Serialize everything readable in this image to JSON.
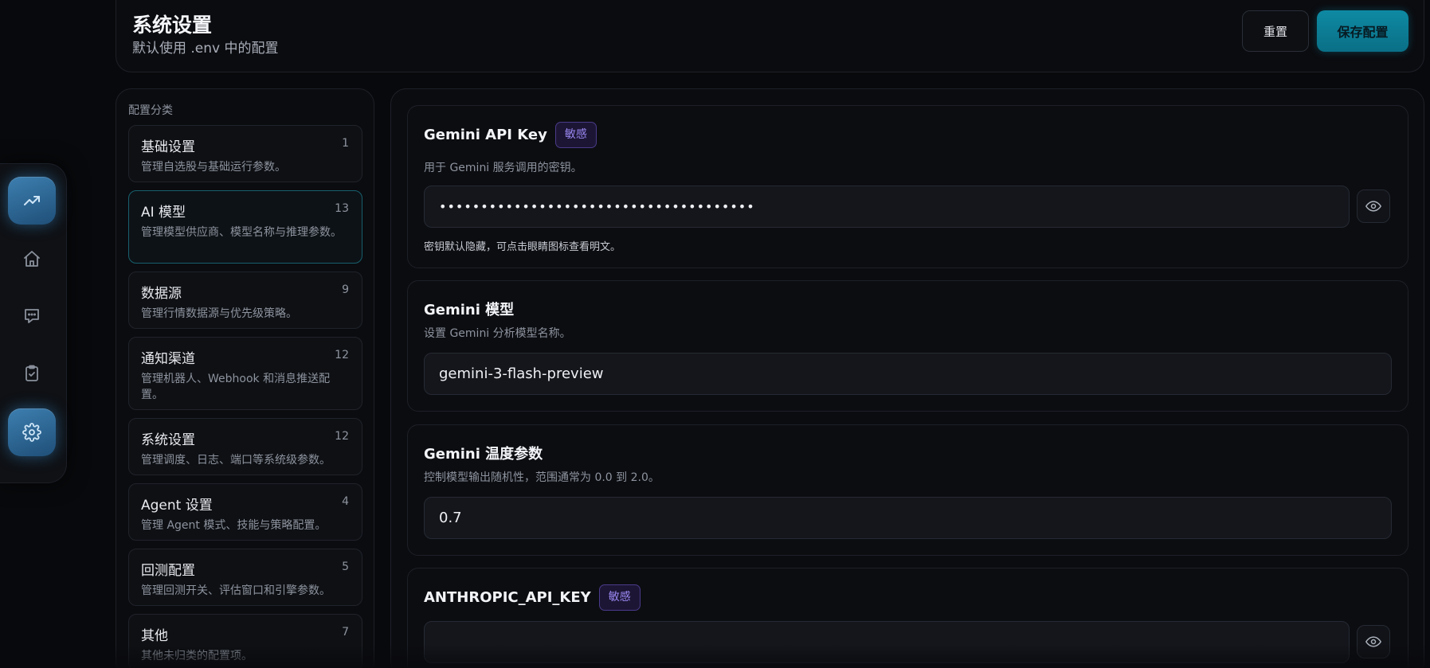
{
  "header": {
    "title": "系统设置",
    "subtitle": "默认使用 .env 中的配置",
    "reset_label": "重置",
    "save_label": "保存配置"
  },
  "nav": {
    "items": [
      {
        "icon": "trending-up-icon",
        "active": true
      },
      {
        "icon": "home-icon",
        "active": false
      },
      {
        "icon": "chat-icon",
        "active": false
      },
      {
        "icon": "clipboard-check-icon",
        "active": false
      },
      {
        "icon": "gear-icon",
        "active": true
      }
    ]
  },
  "categories": {
    "heading": "配置分类",
    "items": [
      {
        "name": "基础设置",
        "count": "1",
        "desc": "管理自选股与基础运行参数。"
      },
      {
        "name": "AI 模型",
        "count": "13",
        "desc": "管理模型供应商、模型名称与推理参数。"
      },
      {
        "name": "数据源",
        "count": "9",
        "desc": "管理行情数据源与优先级策略。"
      },
      {
        "name": "通知渠道",
        "count": "12",
        "desc": "管理机器人、Webhook 和消息推送配置。"
      },
      {
        "name": "系统设置",
        "count": "12",
        "desc": "管理调度、日志、端口等系统级参数。"
      },
      {
        "name": "Agent 设置",
        "count": "4",
        "desc": "管理 Agent 模式、技能与策略配置。"
      },
      {
        "name": "回测配置",
        "count": "5",
        "desc": "管理回测开关、评估窗口和引擎参数。"
      },
      {
        "name": "其他",
        "count": "7",
        "desc": "其他未归类的配置项。"
      }
    ]
  },
  "settings": {
    "gemini_key": {
      "title": "Gemini API Key",
      "badge": "敏感",
      "desc": "用于 Gemini 服务调用的密钥。",
      "value": "••••••••••••••••••••••••••••••••••••••",
      "hint": "密钥默认隐藏，可点击眼睛图标查看明文。"
    },
    "gemini_model": {
      "title": "Gemini 模型",
      "desc": "设置 Gemini 分析模型名称。",
      "value": "gemini-3-flash-preview"
    },
    "gemini_temp": {
      "title": "Gemini 温度参数",
      "desc": "控制模型输出随机性，范围通常为 0.0 到 2.0。",
      "value": "0.7"
    },
    "anthropic_key": {
      "title": "ANTHROPIC_API_KEY",
      "badge": "敏感",
      "value": ""
    }
  },
  "colors": {
    "accent": "#0e8aa3",
    "active_nav": "#2f6f9e",
    "badge_text": "#9a86f0",
    "background": "#08090c"
  }
}
